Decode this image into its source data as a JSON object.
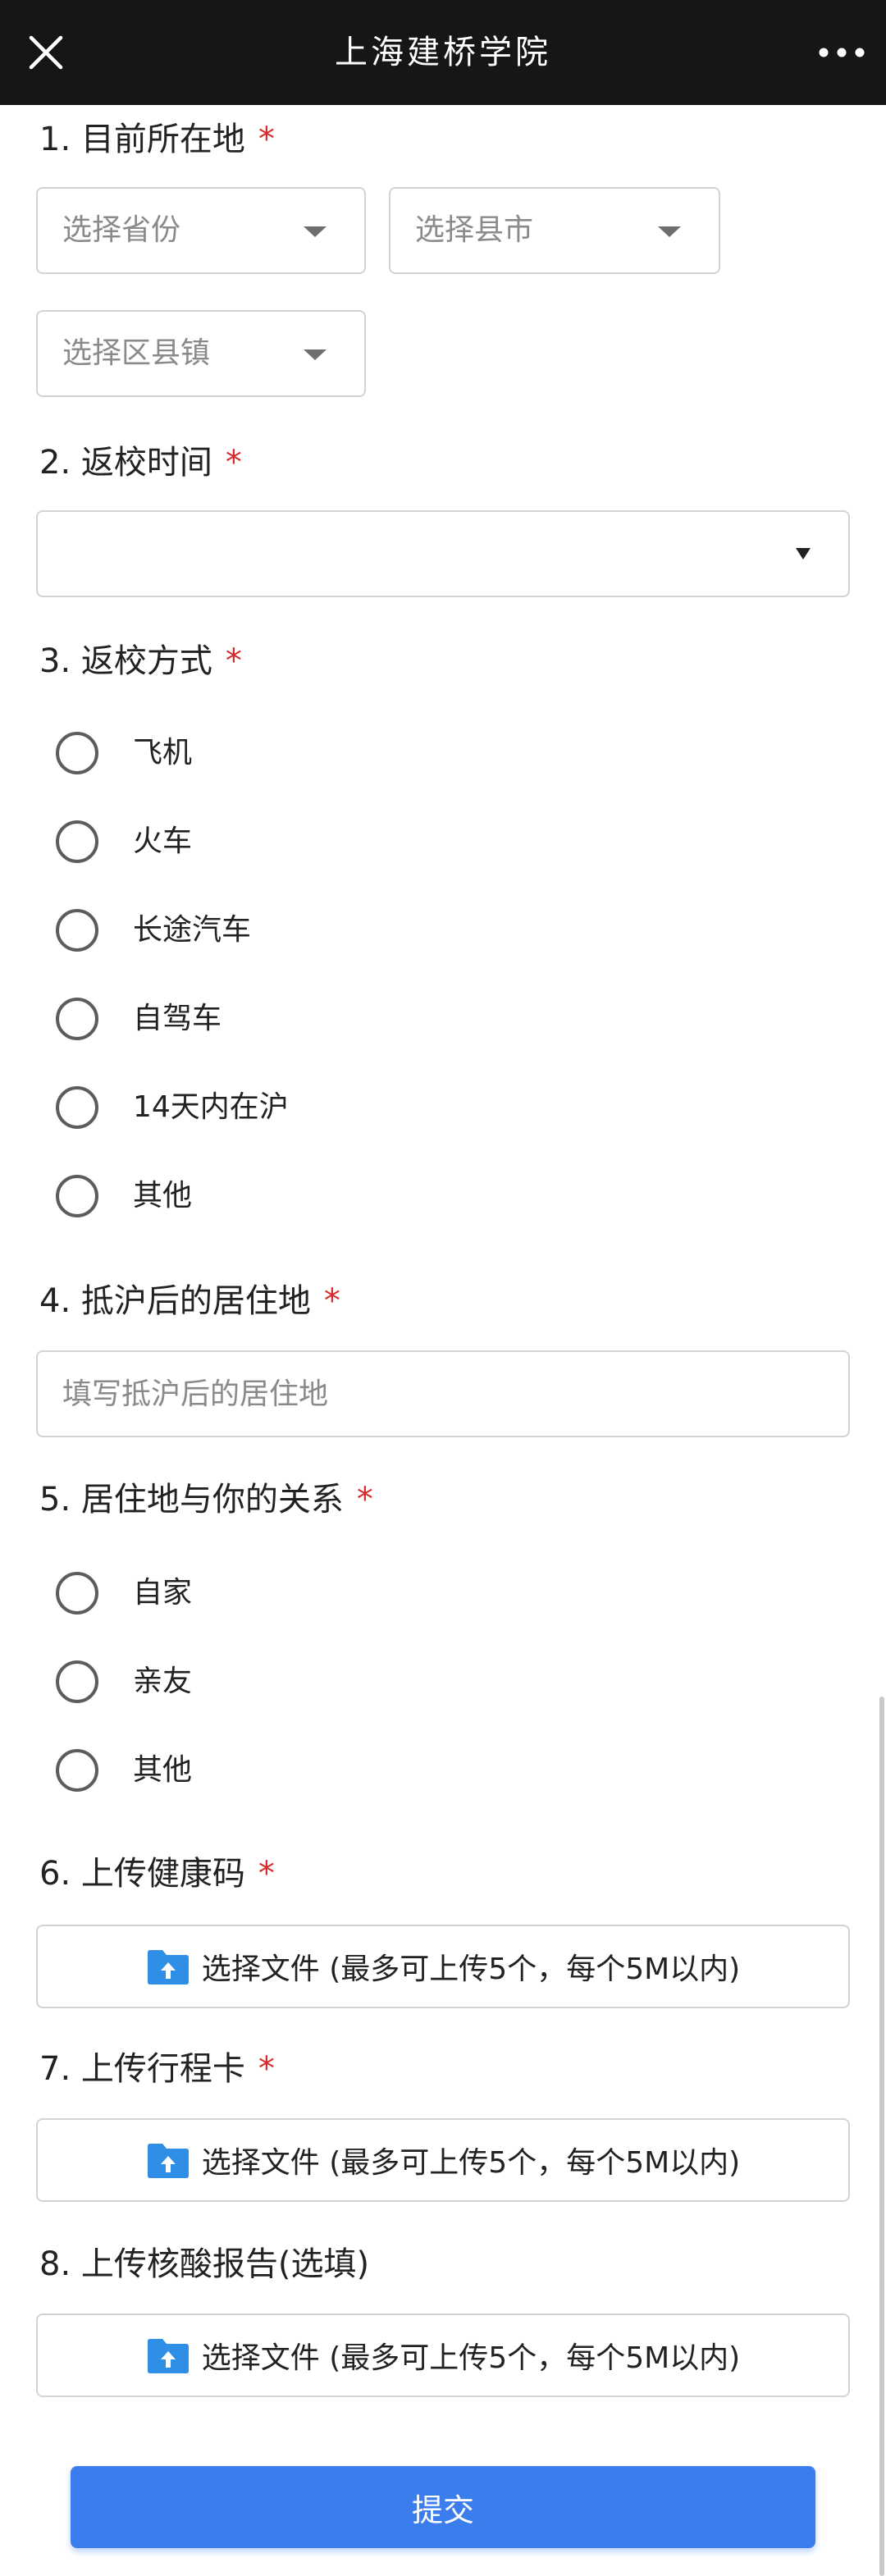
{
  "header": {
    "title": "上海建桥学院",
    "close_icon": "close-icon",
    "more_icon": "more-horizontal-icon",
    "background": "#161616"
  },
  "questions": {
    "q1": {
      "label": "1. 目前所在地",
      "required_mark": "*",
      "province_placeholder": "选择省份",
      "city_placeholder": "选择县市",
      "district_placeholder": "选择区县镇"
    },
    "q2": {
      "label": "2. 返校时间",
      "required_mark": "*",
      "value": ""
    },
    "q3": {
      "label": "3. 返校方式",
      "required_mark": "*",
      "options": [
        "飞机",
        "火车",
        "长途汽车",
        "自驾车",
        "14天内在沪",
        "其他"
      ]
    },
    "q4": {
      "label": "4. 抵沪后的居住地",
      "required_mark": "*",
      "placeholder": "填写抵沪后的居住地"
    },
    "q5": {
      "label": "5. 居住地与你的关系",
      "required_mark": "*",
      "options": [
        "自家",
        "亲友",
        "其他"
      ]
    },
    "q6": {
      "label": "6. 上传健康码",
      "required_mark": "*",
      "upload_text": "选择文件 (最多可上传5个，每个5M以内)"
    },
    "q7": {
      "label": "7. 上传行程卡",
      "required_mark": "*",
      "upload_text": "选择文件 (最多可上传5个，每个5M以内)"
    },
    "q8": {
      "label": "8. 上传核酸报告(选填)",
      "upload_text": "选择文件 (最多可上传5个，每个5M以内)"
    }
  },
  "submit": {
    "label": "提交",
    "color": "#3b7ded"
  },
  "colors": {
    "required": "#d62b2b",
    "upload_icon": "#2f8ee6",
    "border": "#d3d3d3"
  }
}
